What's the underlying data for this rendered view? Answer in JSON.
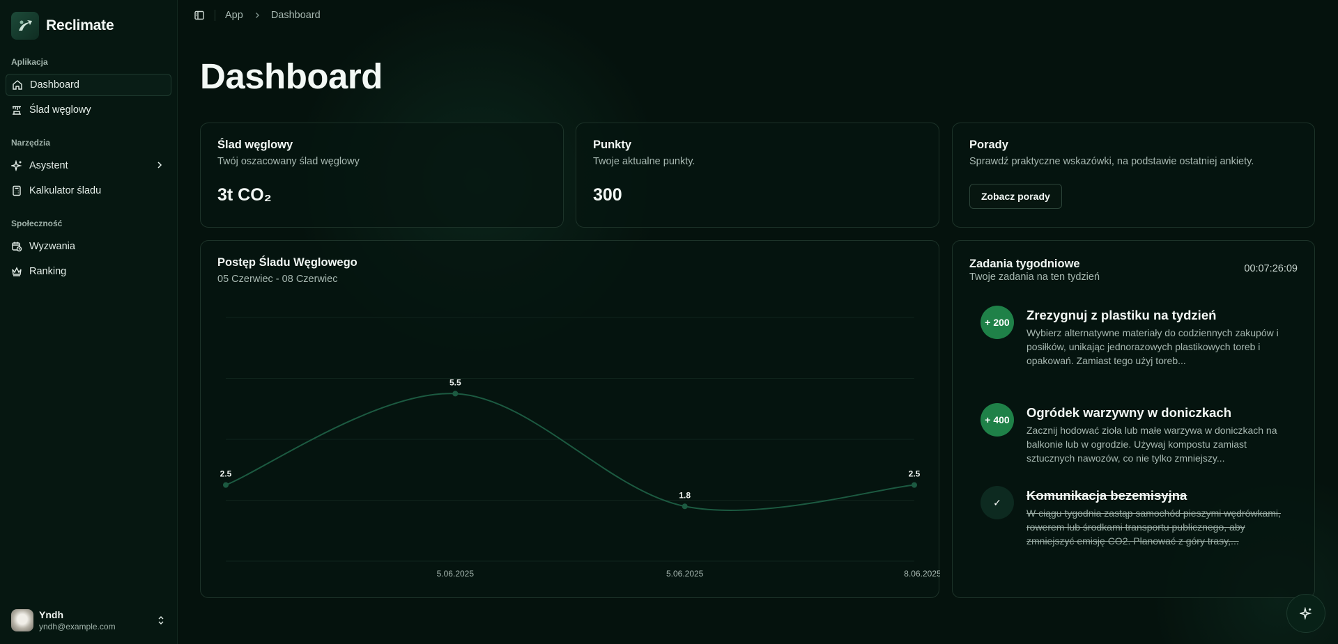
{
  "app": {
    "name": "Reclimate"
  },
  "sidebar": {
    "groups": [
      {
        "label": "Aplikacja",
        "items": [
          {
            "label": "Dashboard",
            "icon": "home-icon",
            "active": true
          },
          {
            "label": "Ślad węglowy",
            "icon": "factory-icon"
          }
        ]
      },
      {
        "label": "Narzędzia",
        "items": [
          {
            "label": "Asystent",
            "icon": "sparkles-icon"
          },
          {
            "label": "Kalkulator śladu",
            "icon": "calculator-icon"
          }
        ]
      },
      {
        "label": "Społeczność",
        "items": [
          {
            "label": "Wyzwania",
            "icon": "calendar-clock-icon"
          },
          {
            "label": "Ranking",
            "icon": "crown-icon"
          }
        ]
      }
    ],
    "user": {
      "name": "Yndh",
      "email": "yndh@example.com"
    }
  },
  "breadcrumb": {
    "items": [
      "App",
      "Dashboard"
    ]
  },
  "page": {
    "title": "Dashboard"
  },
  "cards": {
    "footprint": {
      "title": "Ślad węglowy",
      "subtitle": "Twój oszacowany ślad węglowy",
      "value": "3t CO₂"
    },
    "points": {
      "title": "Punkty",
      "subtitle": "Twoje aktualne punkty.",
      "value": "300"
    },
    "tips": {
      "title": "Porady",
      "subtitle": "Sprawdź praktyczne wskazówki, na podstawie ostatniej ankiety.",
      "button": "Zobacz porady"
    }
  },
  "progress": {
    "title": "Postęp Śladu Węglowego",
    "subtitle": "05 Czerwiec - 08 Czerwiec"
  },
  "chart_data": {
    "type": "line",
    "title": "Postęp Śladu Węglowego",
    "x": [
      "",
      "5.06.2025",
      "5.06.2025",
      "8.06.2025"
    ],
    "series": [
      {
        "values": [
          2.5,
          5.5,
          1.8,
          2.5
        ]
      }
    ],
    "data_labels": [
      "2.5",
      "5.5",
      "1.8",
      "2.5"
    ],
    "ylim": [
      0,
      8
    ],
    "grid": true,
    "color": "#1c5a41"
  },
  "tasks": {
    "title": "Zadania tygodniowe",
    "subtitle": "Twoje zadania na ten tydzień",
    "timer": "00:07:26:09",
    "items": [
      {
        "badge": "+ 200",
        "title": "Zrezygnuj z plastiku na tydzień",
        "desc": "Wybierz alternatywne materiały do codziennych zakupów i posiłków, unikając jednorazowych plastikowych toreb i opakowań. Zamiast tego użyj toreb...",
        "done": false
      },
      {
        "badge": "+ 400",
        "title": "Ogródek warzywny w doniczkach",
        "desc": "Zacznij hodować zioła lub małe warzywa w doniczkach na balkonie lub w ogrodzie. Używaj kompostu zamiast sztucznych nawozów, co nie tylko zmniejszy...",
        "done": false
      },
      {
        "badge": "✓",
        "title": "Komunikacja bezemisyjna",
        "desc": "W ciągu tygodnia zastąp samochód pieszymi wędrówkami, rowerem lub środkami transportu publicznego, aby zmniejszyć emisję CO2. Planować z góry trasy,...",
        "done": true
      }
    ]
  },
  "colors": {
    "accent": "#1f8148",
    "line": "#1c5a41",
    "background": "#05120d"
  }
}
